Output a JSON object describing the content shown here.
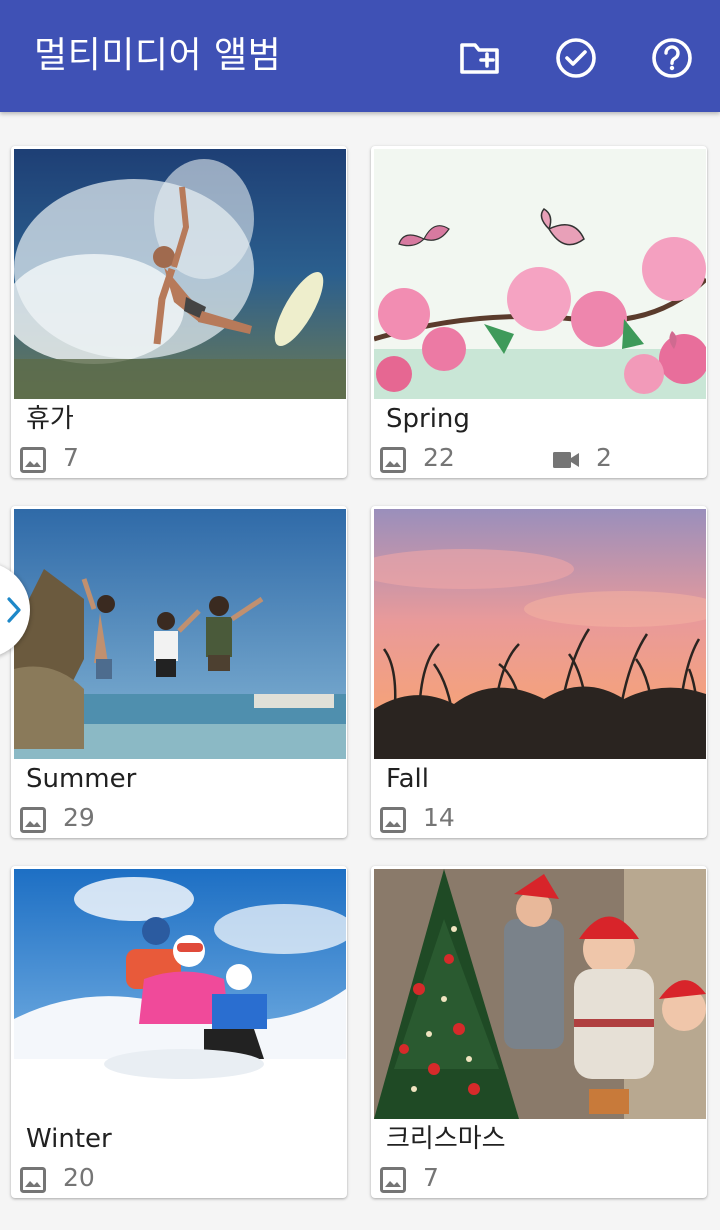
{
  "app_bar": {
    "title": "멀티미디어 앨범",
    "background": "#3f51b5",
    "actions": [
      "add-folder-icon",
      "check-circle-icon",
      "help-icon"
    ]
  },
  "albums": [
    {
      "name": "휴가",
      "photos": "7",
      "videos": null,
      "thumbnail": "surfer in ocean wave"
    },
    {
      "name": "Spring",
      "photos": "22",
      "videos": "2",
      "thumbnail": "butterflies on pink blossoms"
    },
    {
      "name": "Summer",
      "photos": "29",
      "videos": null,
      "thumbnail": "three women jumping at beach"
    },
    {
      "name": "Fall",
      "photos": "14",
      "videos": null,
      "thumbnail": "grass silhouettes at sunset"
    },
    {
      "name": "Winter",
      "photos": "20",
      "videos": null,
      "thumbnail": "family sledding in snow"
    },
    {
      "name": "크리스마스",
      "photos": "7",
      "videos": null,
      "thumbnail": "family decorating christmas tree"
    }
  ],
  "icons": {
    "photo_count": "image-icon",
    "video_count": "videocam-icon",
    "drawer_tab": "chevron-right-icon"
  },
  "colors": {
    "text_primary": "#212121",
    "text_secondary": "#757575",
    "background": "#f5f5f5",
    "drawer_chevron": "#1e88c8"
  }
}
